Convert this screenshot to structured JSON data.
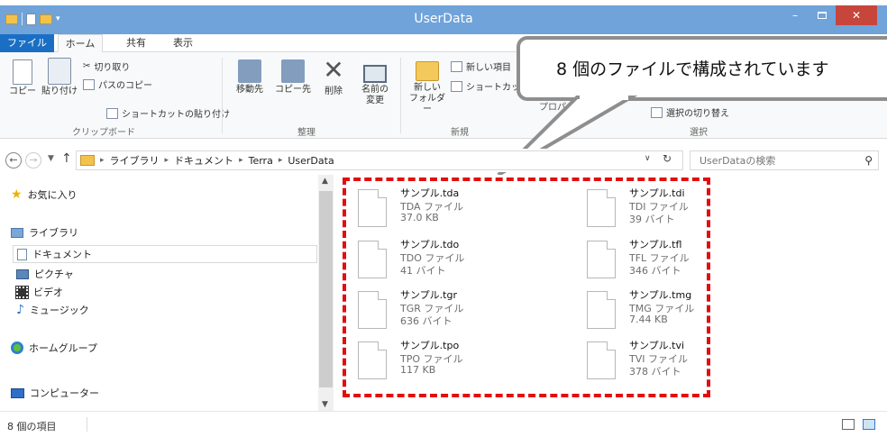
{
  "window": {
    "title": "UserData"
  },
  "ribbon_tabs": [
    "ファイル",
    "ホーム",
    "共有",
    "表示"
  ],
  "clipboard": {
    "copy": "コピー",
    "paste": "貼り付け",
    "cut": "切り取り",
    "copy_path": "パスのコピー",
    "paste_shortcut": "ショートカットの貼り付け",
    "group": "クリップボード"
  },
  "organize": {
    "move_to": "移動先",
    "copy_to": "コピー先",
    "delete": "削除",
    "rename_line1": "名前の",
    "rename_line2": "変更",
    "group": "整理"
  },
  "new_group": {
    "new_folder_line1": "新しい",
    "new_folder_line2": "フォルダー",
    "new_item": "新しい項目",
    "shortcut": "ショートカッ",
    "group": "新規"
  },
  "open_group": {
    "label_fragment": "プロパ"
  },
  "select_group": {
    "invert": "選択の切り替え",
    "group": "選択"
  },
  "callout": {
    "text": "8 個のファイルで構成されています"
  },
  "address": {
    "crumbs": [
      "ライブラリ",
      "ドキュメント",
      "Terra",
      "UserData"
    ],
    "search_placeholder": "UserDataの検索"
  },
  "nav": {
    "favorites": "お気に入り",
    "libraries": "ライブラリ",
    "documents": "ドキュメント",
    "pictures": "ピクチャ",
    "videos": "ビデオ",
    "music": "ミュージック",
    "homegroup": "ホームグループ",
    "computer": "コンピューター"
  },
  "files": [
    {
      "name": "サンプル.tda",
      "type": "TDA ファイル",
      "size": "37.0 KB"
    },
    {
      "name": "サンプル.tdi",
      "type": "TDI ファイル",
      "size": "39 バイト"
    },
    {
      "name": "サンプル.tdo",
      "type": "TDO ファイル",
      "size": "41 バイト"
    },
    {
      "name": "サンプル.tfl",
      "type": "TFL ファイル",
      "size": "346 バイト"
    },
    {
      "name": "サンプル.tgr",
      "type": "TGR ファイル",
      "size": "636 バイト"
    },
    {
      "name": "サンプル.tmg",
      "type": "TMG ファイル",
      "size": "7.44 KB"
    },
    {
      "name": "サンプル.tpo",
      "type": "TPO ファイル",
      "size": "117 KB"
    },
    {
      "name": "サンプル.tvi",
      "type": "TVI ファイル",
      "size": "378 バイト"
    }
  ],
  "status": {
    "item_count": "8 個の項目"
  },
  "colors": {
    "titlebar": "#6fa3da",
    "file_tab": "#1a6fc4",
    "close": "#c7463c",
    "highlight_dash": "#e20e0e",
    "callout_border": "#8e8e8e"
  }
}
